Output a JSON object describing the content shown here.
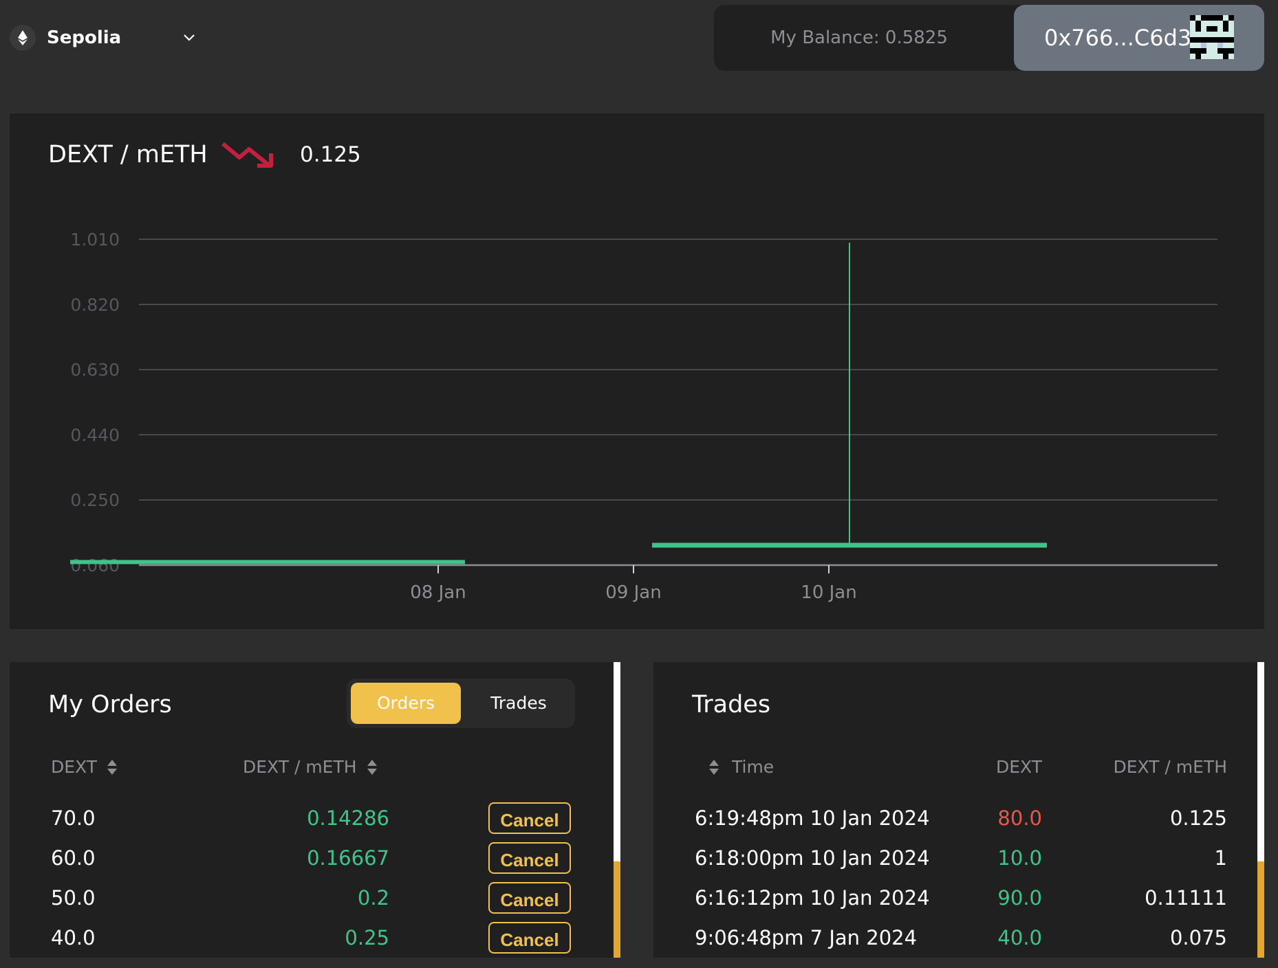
{
  "network": {
    "name": "Sepolia"
  },
  "account": {
    "balance": "My Balance: 0.5825",
    "address": "0x766...C6d3"
  },
  "market": {
    "pair": "DEXT / mETH",
    "price": "0.125",
    "trend": "down"
  },
  "chart_data": {
    "type": "candlestick",
    "y_ticks": [
      "1.010",
      "0.820",
      "0.630",
      "0.440",
      "0.250",
      "0.060"
    ],
    "ylim": [
      0.06,
      1.01
    ],
    "x_ticks": [
      "08 Jan",
      "09 Jan",
      "10 Jan"
    ],
    "candles": [
      {
        "date": "07 Jan",
        "open": 0.075,
        "high": 0.075,
        "low": 0.075,
        "close": 0.075,
        "color": "#3fc48a"
      },
      {
        "date": "10 Jan",
        "open": 0.111,
        "high": 1.0,
        "low": 0.111,
        "close": 0.125,
        "color": "#3fc48a"
      }
    ],
    "grid": true
  },
  "orders": {
    "title": "My Orders",
    "tabs": [
      "Orders",
      "Trades"
    ],
    "columns": [
      "DEXT",
      "DEXT / mETH"
    ],
    "cancel_label": "Cancel",
    "rows": [
      {
        "amount": "70.0",
        "price": "0.14286"
      },
      {
        "amount": "60.0",
        "price": "0.16667"
      },
      {
        "amount": "50.0",
        "price": "0.2"
      },
      {
        "amount": "40.0",
        "price": "0.25"
      }
    ]
  },
  "trades": {
    "title": "Trades",
    "columns": [
      "Time",
      "DEXT",
      "DEXT / mETH"
    ],
    "rows": [
      {
        "time": "6:19:48pm 10 Jan 2024",
        "amount": "80.0",
        "price": "0.125",
        "side": "sell"
      },
      {
        "time": "6:18:00pm 10 Jan 2024",
        "amount": "10.0",
        "price": "1",
        "side": "buy"
      },
      {
        "time": "6:16:12pm 10 Jan 2024",
        "amount": "90.0",
        "price": "0.11111",
        "side": "buy"
      },
      {
        "time": "9:06:48pm 7 Jan 2024",
        "amount": "40.0",
        "price": "0.075",
        "side": "buy"
      }
    ]
  },
  "colors": {
    "buy": "#3fc48a",
    "sell": "#e5594e",
    "accent": "#f0c14b",
    "trend_down": "#c0213f"
  }
}
